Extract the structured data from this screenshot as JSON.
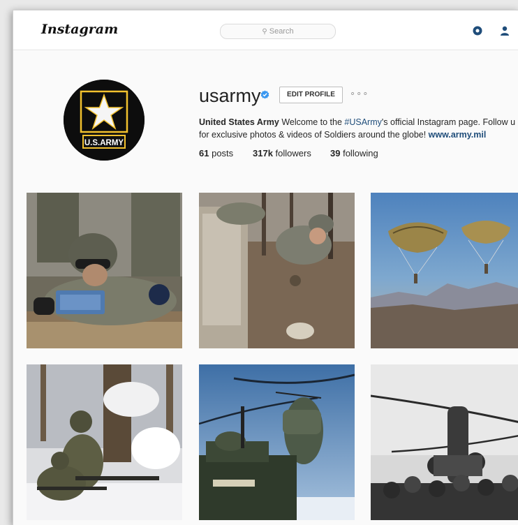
{
  "header": {
    "logo": "Instagram",
    "search_placeholder": "Search",
    "icons": [
      "compass-icon",
      "user-icon"
    ]
  },
  "profile": {
    "username": "usarmy",
    "verified": true,
    "edit_button": "EDIT PROFILE",
    "more_label": "∘∘∘",
    "avatar_text": "U.S.ARMY",
    "bio": {
      "name": "United States Army",
      "text1": " Welcome to the ",
      "hashtag": "#USArmy",
      "text2": "'s official Instagram page. Follow u",
      "text3": "for exclusive photos & videos of Soldiers around the globe! ",
      "website": "www.army.mil"
    },
    "stats": {
      "posts_count": "61",
      "posts_label": "posts",
      "followers_count": "317k",
      "followers_label": "followers",
      "following_count": "39",
      "following_label": "following"
    }
  },
  "posts": [
    {
      "subject": "soldier-with-claymore-mine"
    },
    {
      "subject": "soldier-throwing-grenade"
    },
    {
      "subject": "parachutists-over-mountains"
    },
    {
      "subject": "soldiers-in-snow"
    },
    {
      "subject": "helicopter-over-vehicle"
    },
    {
      "subject": "chinook-with-troops"
    }
  ],
  "colors": {
    "link": "#1f4d7a",
    "verified": "#3897f0",
    "army_gold": "#f2c12e"
  }
}
